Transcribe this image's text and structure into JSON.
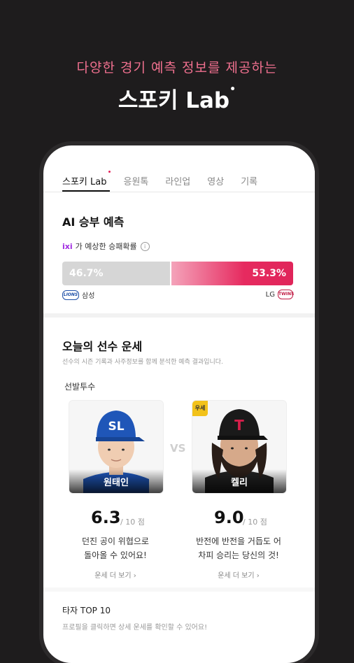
{
  "promo": {
    "subtitle": "다양한 경기 예측 정보를 제공하는",
    "title": "스포키 Lab",
    "title_dot": "•"
  },
  "tabs": [
    {
      "label": "스포키 Lab",
      "active": true
    },
    {
      "label": "응원톡"
    },
    {
      "label": "라인업"
    },
    {
      "label": "영상"
    },
    {
      "label": "기록"
    }
  ],
  "ai_prediction": {
    "title": "AI 승부 예측",
    "brand": "ixi",
    "caption": "가 예상한 승패확률",
    "info_icon": "info-icon",
    "home": {
      "team": "삼성",
      "logo_text": "LIONS",
      "pct": "46.7%",
      "value": 46.7
    },
    "away": {
      "team": "LG",
      "logo_text": "TWINS",
      "pct": "53.3%",
      "value": 53.3
    },
    "colors": {
      "home_bar": "#d6d6d6",
      "away_bar": "#e62a5f"
    }
  },
  "fortune": {
    "title": "오늘의 선수 운세",
    "description": "선수의 시즌 기록과 사주정보를 함께 분석한 예측 결과입니다.",
    "starter_label": "선발투수",
    "vs": "VS",
    "players": [
      {
        "name": "원태인",
        "score": "6.3",
        "max": "/ 10 점",
        "comment_line1": "던진 공이 위협으로",
        "comment_line2": "돌아올 수 있어요!",
        "more": "운세 더 보기 ›",
        "cap_text": "SL",
        "cap_color": "#1f56b8"
      },
      {
        "name": "켈리",
        "badge": "우세",
        "score": "9.0",
        "max": "/ 10 점",
        "comment_line1": "반전에 반전을 거듭도 어",
        "comment_line2": "차피 승리는 당신의 것!",
        "more": "운세 더 보기 ›",
        "cap_text": "T",
        "cap_color": "#1a1a1a"
      }
    ]
  },
  "batters": {
    "title": "타자 TOP 10",
    "subtitle": "프로필을 클릭하면 상세 운세를 확인할 수 있어요!"
  }
}
